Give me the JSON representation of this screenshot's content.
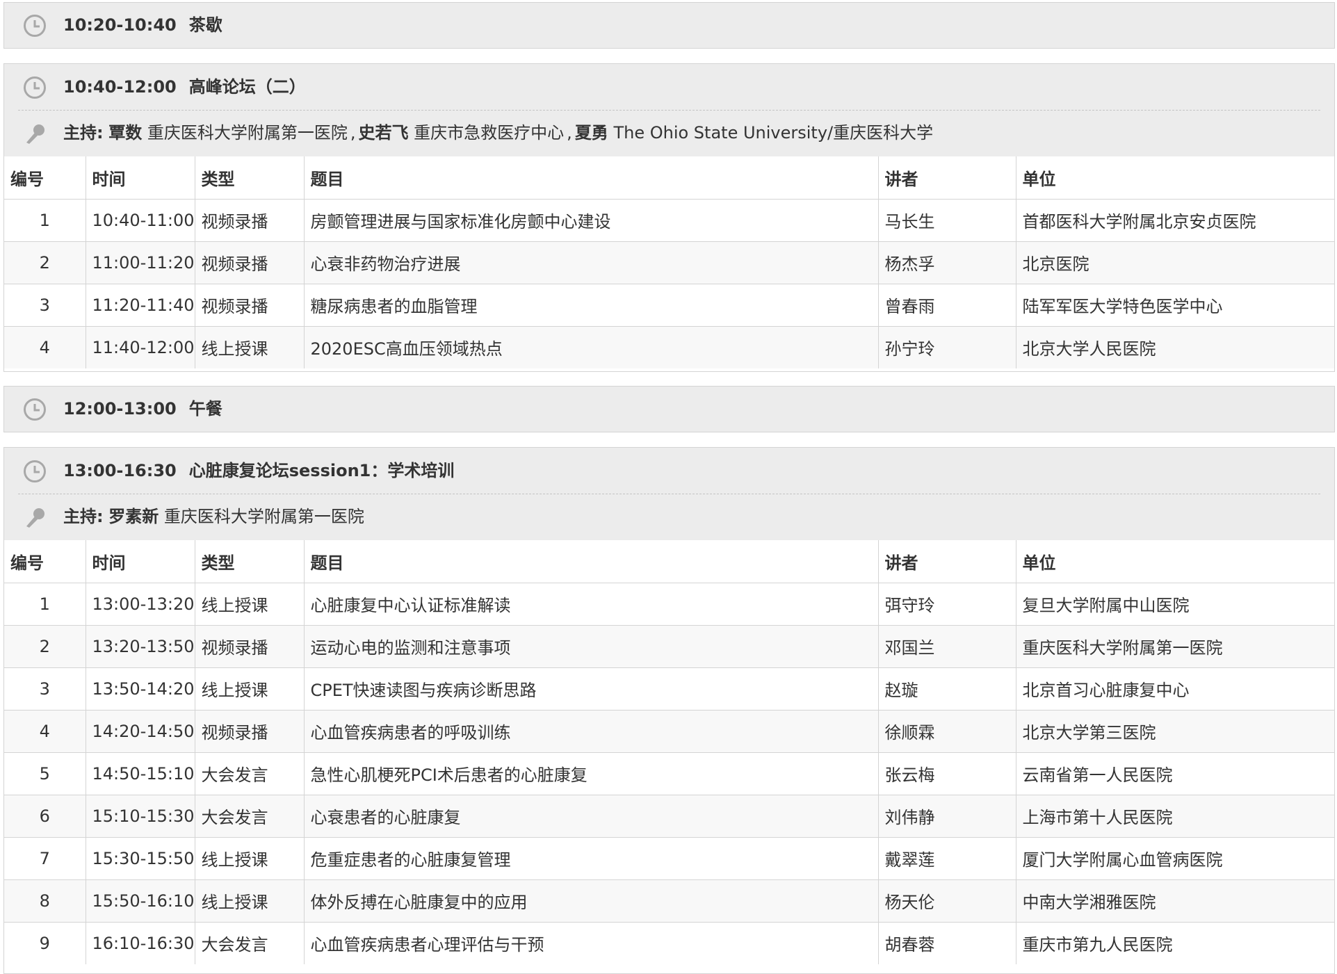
{
  "sections": [
    {
      "time": "10:20-10:40",
      "title": "茶歇"
    },
    {
      "time": "10:40-12:00",
      "title": "高峰论坛（二）",
      "host_label": "主持:",
      "hosts": [
        {
          "name": "覃数",
          "org": "重庆医科大学附属第一医院"
        },
        {
          "name": "史若飞",
          "org": "重庆市急救医疗中心"
        },
        {
          "name": "夏勇",
          "org": "The Ohio State University/重庆医科大学"
        }
      ],
      "columns": [
        "编号",
        "时间",
        "类型",
        "题目",
        "讲者",
        "单位"
      ],
      "rows": [
        [
          "1",
          "10:40-11:00",
          "视频录播",
          "房颤管理进展与国家标准化房颤中心建设",
          "马长生",
          "首都医科大学附属北京安贞医院"
        ],
        [
          "2",
          "11:00-11:20",
          "视频录播",
          "心衰非药物治疗进展",
          "杨杰孚",
          "北京医院"
        ],
        [
          "3",
          "11:20-11:40",
          "视频录播",
          "糖尿病患者的血脂管理",
          "曾春雨",
          "陆军军医大学特色医学中心"
        ],
        [
          "4",
          "11:40-12:00",
          "线上授课",
          "2020ESC高血压领域热点",
          "孙宁玲",
          "北京大学人民医院"
        ]
      ]
    },
    {
      "time": "12:00-13:00",
      "title": "午餐"
    },
    {
      "time": "13:00-16:30",
      "title": "心脏康复论坛session1：学术培训",
      "host_label": "主持:",
      "hosts": [
        {
          "name": "罗素新",
          "org": "重庆医科大学附属第一医院"
        }
      ],
      "columns": [
        "编号",
        "时间",
        "类型",
        "题目",
        "讲者",
        "单位"
      ],
      "rows": [
        [
          "1",
          "13:00-13:20",
          "线上授课",
          "心脏康复中心认证标准解读",
          "弭守玲",
          "复旦大学附属中山医院"
        ],
        [
          "2",
          "13:20-13:50",
          "视频录播",
          "运动心电的监测和注意事项",
          "邓国兰",
          "重庆医科大学附属第一医院"
        ],
        [
          "3",
          "13:50-14:20",
          "线上授课",
          "CPET快速读图与疾病诊断思路",
          "赵璇",
          "北京首习心脏康复中心"
        ],
        [
          "4",
          "14:20-14:50",
          "视频录播",
          "心血管疾病患者的呼吸训练",
          "徐顺霖",
          "北京大学第三医院"
        ],
        [
          "5",
          "14:50-15:10",
          "大会发言",
          "急性心肌梗死PCI术后患者的心脏康复",
          "张云梅",
          "云南省第一人民医院"
        ],
        [
          "6",
          "15:10-15:30",
          "大会发言",
          "心衰患者的心脏康复",
          "刘伟静",
          "上海市第十人民医院"
        ],
        [
          "7",
          "15:30-15:50",
          "线上授课",
          "危重症患者的心脏康复管理",
          "戴翠莲",
          "厦门大学附属心血管病医院"
        ],
        [
          "8",
          "15:50-16:10",
          "线上授课",
          "体外反搏在心脏康复中的应用",
          "杨天伦",
          "中南大学湘雅医院"
        ],
        [
          "9",
          "16:10-16:30",
          "大会发言",
          "心血管疾病患者心理评估与干预",
          "胡春蓉",
          "重庆市第九人民医院"
        ]
      ]
    }
  ],
  "icons": {
    "clock": "clock-icon",
    "microphone": "microphone-icon"
  },
  "colors": {
    "header_bg": "#ececec",
    "border": "#d4d4d4",
    "icon_gray": "#a8a8a8",
    "text": "#333333"
  }
}
